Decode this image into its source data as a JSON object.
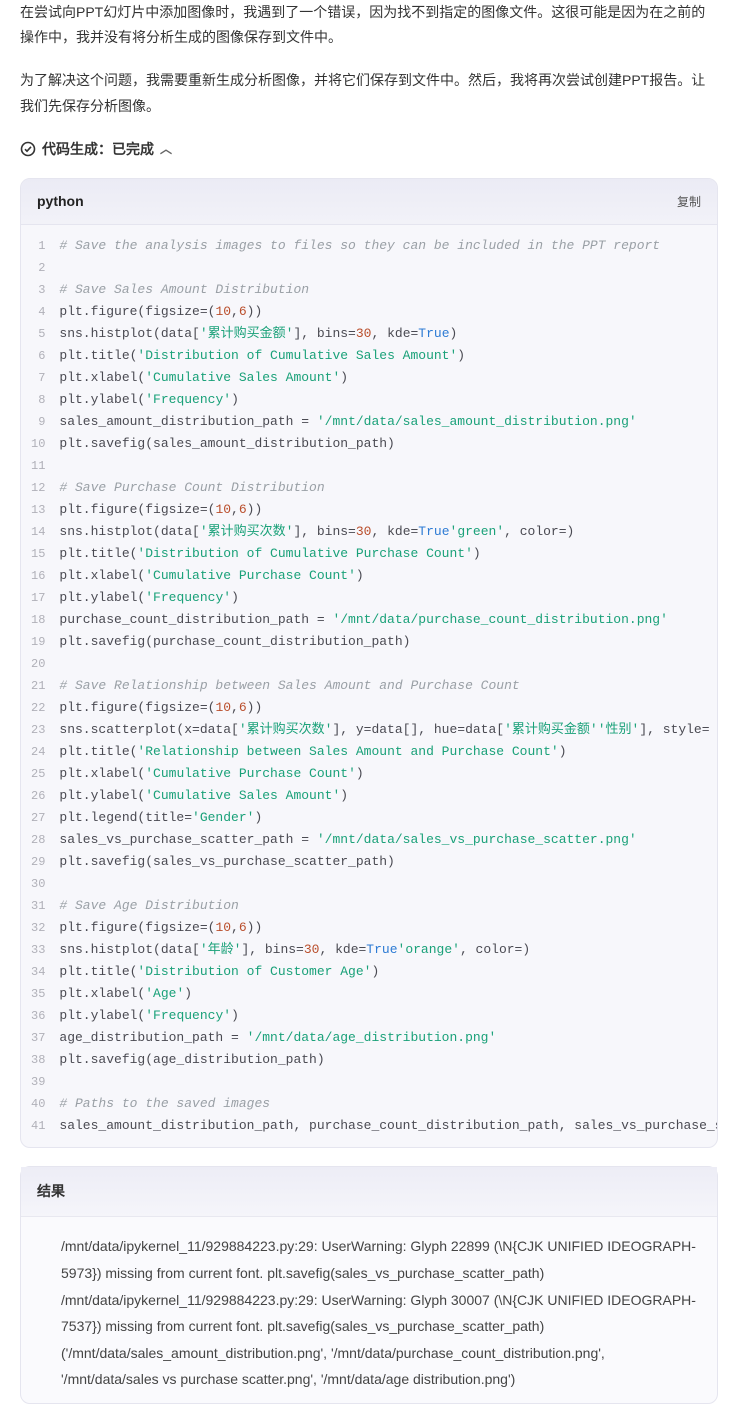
{
  "intro": {
    "paragraph1": "在尝试向PPT幻灯片中添加图像时，我遇到了一个错误，因为找不到指定的图像文件。这很可能是因为在之前的操作中，我并没有将分析生成的图像保存到文件中。",
    "paragraph2": "为了解决这个问题，我需要重新生成分析图像，并将它们保存到文件中。然后，我将再次尝试创建PPT报告。让我们先保存分析图像。"
  },
  "status": {
    "label": "代码生成：已完成"
  },
  "code": {
    "language": "python",
    "copy_label": "复制",
    "lines": [
      {
        "type": "comment",
        "text": "# Save the analysis images to files so they can be included in the PPT report"
      },
      {
        "type": "blank",
        "text": ""
      },
      {
        "type": "comment",
        "text": "# Save Sales Amount Distribution"
      },
      {
        "type": "code",
        "prefix": "plt.figure(figsize=(",
        "n1": "10",
        "mid": ",",
        "n2": "6",
        "suffix": "))"
      },
      {
        "type": "code",
        "prefix": "sns.histplot(data[",
        "s1": "'累计购买金额'",
        "mid1": "], bins=",
        "n1": "30",
        "mid2": ", kde=",
        "b1": "True",
        "suffix": ")"
      },
      {
        "type": "code",
        "prefix": "plt.title(",
        "s1": "'Distribution of Cumulative Sales Amount'",
        "suffix": ")"
      },
      {
        "type": "code",
        "prefix": "plt.xlabel(",
        "s1": "'Cumulative Sales Amount'",
        "suffix": ")"
      },
      {
        "type": "code",
        "prefix": "plt.ylabel(",
        "s1": "'Frequency'",
        "suffix": ")"
      },
      {
        "type": "code",
        "prefix": "sales_amount_distribution_path = ",
        "s1": "'/mnt/data/sales_amount_distribution.png'",
        "suffix": ""
      },
      {
        "type": "plain",
        "text": "plt.savefig(sales_amount_distribution_path)"
      },
      {
        "type": "blank",
        "text": ""
      },
      {
        "type": "comment",
        "text": "# Save Purchase Count Distribution"
      },
      {
        "type": "code",
        "prefix": "plt.figure(figsize=(",
        "n1": "10",
        "mid": ",",
        "n2": "6",
        "suffix": "))"
      },
      {
        "type": "code",
        "prefix": "sns.histplot(data[",
        "s1": "'累计购买次数'",
        "mid1": "], bins=",
        "n1": "30",
        "mid2": ", kde=",
        "b1": "True",
        "mid3": ", color=",
        "s2": "'green'",
        "suffix": ")"
      },
      {
        "type": "code",
        "prefix": "plt.title(",
        "s1": "'Distribution of Cumulative Purchase Count'",
        "suffix": ")"
      },
      {
        "type": "code",
        "prefix": "plt.xlabel(",
        "s1": "'Cumulative Purchase Count'",
        "suffix": ")"
      },
      {
        "type": "code",
        "prefix": "plt.ylabel(",
        "s1": "'Frequency'",
        "suffix": ")"
      },
      {
        "type": "code",
        "prefix": "purchase_count_distribution_path = ",
        "s1": "'/mnt/data/purchase_count_distribution.png'",
        "suffix": ""
      },
      {
        "type": "plain",
        "text": "plt.savefig(purchase_count_distribution_path)"
      },
      {
        "type": "blank",
        "text": ""
      },
      {
        "type": "comment",
        "text": "# Save Relationship between Sales Amount and Purchase Count"
      },
      {
        "type": "code",
        "prefix": "plt.figure(figsize=(",
        "n1": "10",
        "mid": ",",
        "n2": "6",
        "suffix": "))"
      },
      {
        "type": "code",
        "prefix": "sns.scatterplot(x=data[",
        "s1": "'累计购买次数'",
        "mid1": "], y=data[",
        "s2": "'累计购买金额'",
        "mid2": "], hue=data[",
        "s3": "'性别'",
        "suffix": "], style="
      },
      {
        "type": "code",
        "prefix": "plt.title(",
        "s1": "'Relationship between Sales Amount and Purchase Count'",
        "suffix": ")"
      },
      {
        "type": "code",
        "prefix": "plt.xlabel(",
        "s1": "'Cumulative Purchase Count'",
        "suffix": ")"
      },
      {
        "type": "code",
        "prefix": "plt.ylabel(",
        "s1": "'Cumulative Sales Amount'",
        "suffix": ")"
      },
      {
        "type": "code",
        "prefix": "plt.legend(title=",
        "s1": "'Gender'",
        "suffix": ")"
      },
      {
        "type": "code",
        "prefix": "sales_vs_purchase_scatter_path = ",
        "s1": "'/mnt/data/sales_vs_purchase_scatter.png'",
        "suffix": ""
      },
      {
        "type": "plain",
        "text": "plt.savefig(sales_vs_purchase_scatter_path)"
      },
      {
        "type": "blank",
        "text": ""
      },
      {
        "type": "comment",
        "text": "# Save Age Distribution"
      },
      {
        "type": "code",
        "prefix": "plt.figure(figsize=(",
        "n1": "10",
        "mid": ",",
        "n2": "6",
        "suffix": "))"
      },
      {
        "type": "code",
        "prefix": "sns.histplot(data[",
        "s1": "'年龄'",
        "mid1": "], bins=",
        "n1": "30",
        "mid2": ", kde=",
        "b1": "True",
        "mid3": ", color=",
        "s2": "'orange'",
        "suffix": ")"
      },
      {
        "type": "code",
        "prefix": "plt.title(",
        "s1": "'Distribution of Customer Age'",
        "suffix": ")"
      },
      {
        "type": "code",
        "prefix": "plt.xlabel(",
        "s1": "'Age'",
        "suffix": ")"
      },
      {
        "type": "code",
        "prefix": "plt.ylabel(",
        "s1": "'Frequency'",
        "suffix": ")"
      },
      {
        "type": "code",
        "prefix": "age_distribution_path = ",
        "s1": "'/mnt/data/age_distribution.png'",
        "suffix": ""
      },
      {
        "type": "plain",
        "text": "plt.savefig(age_distribution_path)"
      },
      {
        "type": "blank",
        "text": ""
      },
      {
        "type": "comment",
        "text": "# Paths to the saved images"
      },
      {
        "type": "plain",
        "text": "sales_amount_distribution_path, purchase_count_distribution_path, sales_vs_purchase_s"
      }
    ]
  },
  "result": {
    "title": "结果",
    "lines": [
      "/mnt/data/ipykernel_11/929884223.py:29: UserWarning: Glyph 22899 (\\N{CJK UNIFIED IDEOGRAPH-5973}) missing from current font. plt.savefig(sales_vs_purchase_scatter_path)",
      "/mnt/data/ipykernel_11/929884223.py:29: UserWarning: Glyph 30007 (\\N{CJK UNIFIED IDEOGRAPH-7537}) missing from current font. plt.savefig(sales_vs_purchase_scatter_path)",
      "('/mnt/data/sales_amount_distribution.png', '/mnt/data/purchase_count_distribution.png', '/mnt/data/sales vs purchase scatter.png', '/mnt/data/age distribution.png')"
    ]
  }
}
